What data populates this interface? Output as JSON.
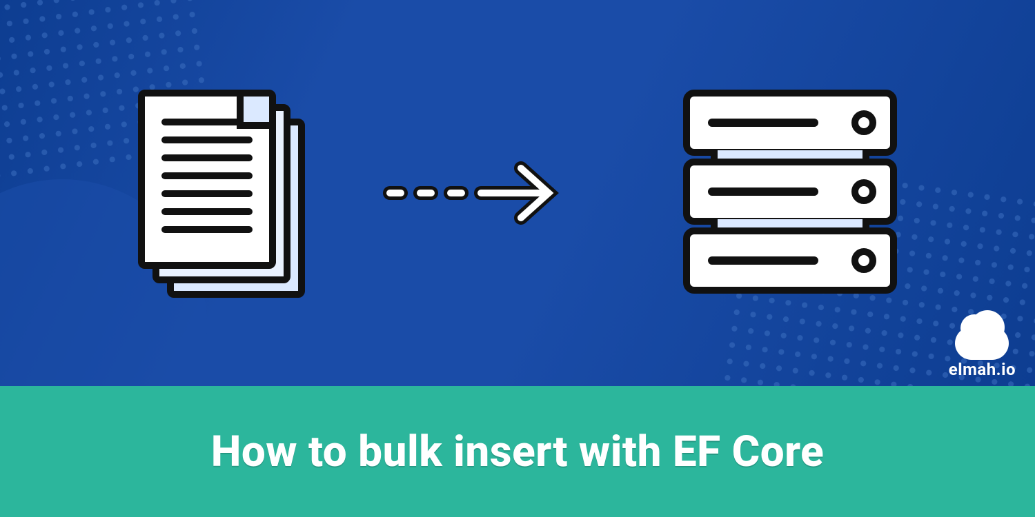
{
  "title": "How to bulk insert with EF Core",
  "brand": "elmah.io",
  "colors": {
    "hero_start": "#0d3d91",
    "hero_end": "#1a4ca8",
    "band": "#2cb69c",
    "accent_light": "#dbe9ff"
  },
  "diagram": {
    "left_icon": "document-stack",
    "middle_icon": "dashed-arrow-right",
    "right_icon": "server-stack",
    "document_lines": 7,
    "servers": 3
  }
}
